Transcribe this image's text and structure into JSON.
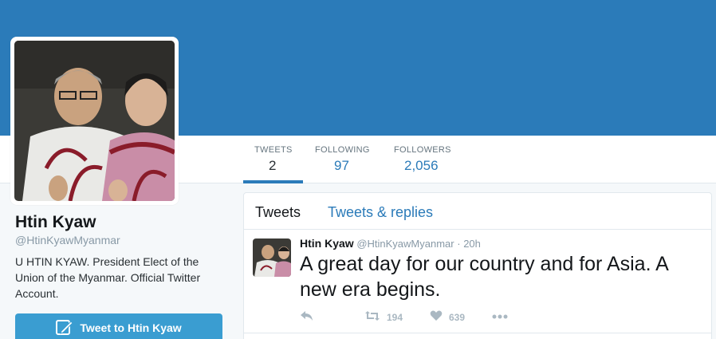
{
  "profile": {
    "name": "Htin Kyaw",
    "handle": "@HtinKyawMyanmar",
    "bio": "U HTIN KYAW. President Elect of the Union of the Myanmar. Official Twitter Account.",
    "tweet_to_label": "Tweet to Htin Kyaw"
  },
  "nav": {
    "stats": [
      {
        "label": "TWEETS",
        "value": "2"
      },
      {
        "label": "FOLLOWING",
        "value": "97"
      },
      {
        "label": "FOLLOWERS",
        "value": "2,056"
      }
    ]
  },
  "stream": {
    "tabs": [
      {
        "label": "Tweets"
      },
      {
        "label": "Tweets & replies"
      }
    ],
    "tweets": [
      {
        "fullname": "Htin Kyaw",
        "handle": "@HtinKyawMyanmar",
        "separator": "·",
        "time": "20h",
        "text": "A great day for our country and for Asia. A new era begins.",
        "retweets": "194",
        "likes": "639"
      }
    ]
  },
  "colors": {
    "banner": "#2b7bb9",
    "accent": "#2b7bb9",
    "button": "#3a9dd1"
  },
  "icons": [
    "profile-photo",
    "feather-icon",
    "reply-icon",
    "retweet-icon",
    "heart-icon",
    "more-icon"
  ]
}
